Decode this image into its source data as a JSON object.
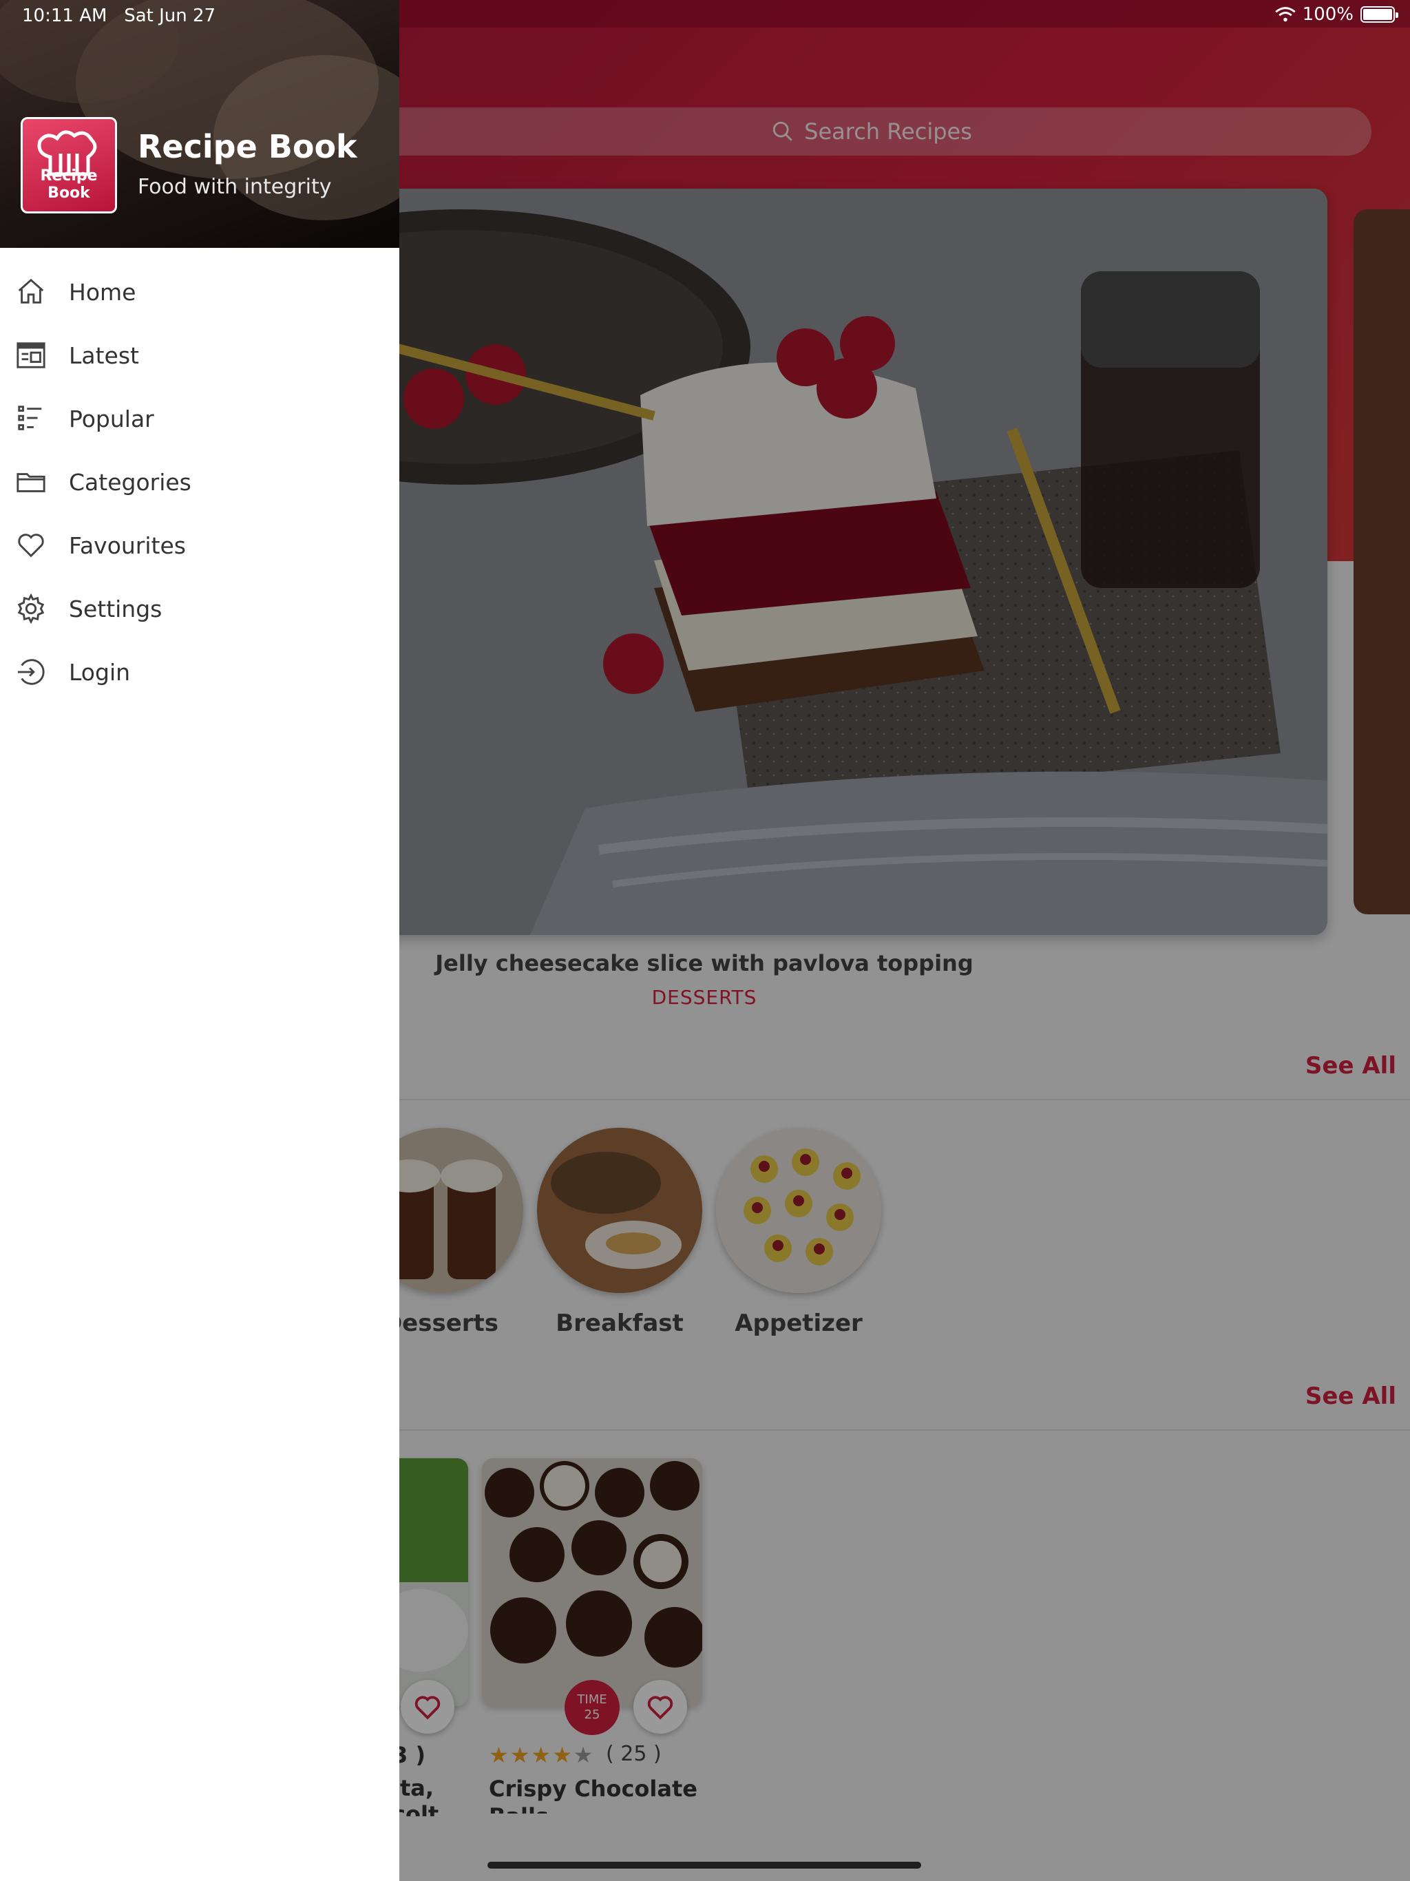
{
  "status_bar": {
    "time": "10:11 AM",
    "date": "Sat Jun 27",
    "battery_text": "100%"
  },
  "drawer": {
    "app_name": "Recipe Book",
    "tagline": "Food with integrity",
    "logo_text": "Recipe Book",
    "items": [
      {
        "label": "Home",
        "icon": "home-icon"
      },
      {
        "label": "Latest",
        "icon": "latest-icon"
      },
      {
        "label": "Popular",
        "icon": "popular-icon"
      },
      {
        "label": "Categories",
        "icon": "folder-icon"
      },
      {
        "label": "Favourites",
        "icon": "heart-icon"
      },
      {
        "label": "Settings",
        "icon": "gear-icon"
      },
      {
        "label": "Login",
        "icon": "login-icon"
      }
    ]
  },
  "search": {
    "placeholder": "Search Recipes"
  },
  "featured": {
    "title": "Jelly cheesecake slice with pavlova topping",
    "category": "DESSERTS"
  },
  "categories_section": {
    "see_all": "See All",
    "items": [
      "Desserts",
      "Breakfast",
      "Appetizer"
    ],
    "first_label_visible": "Desserts"
  },
  "recipes_section": {
    "see_all": "See All",
    "partial_rating": "3 )",
    "partial_title_line1": "ita,",
    "partial_title_line2": "colt",
    "card": {
      "time_label": "TIME",
      "time_value": "25",
      "rating": 4,
      "rating_count": "( 25 )",
      "title": "Crispy Chocolate Balls"
    }
  },
  "colors": {
    "accent": "#d3213f",
    "header_gradient_start": "#b0173a",
    "star": "#f0a020"
  }
}
